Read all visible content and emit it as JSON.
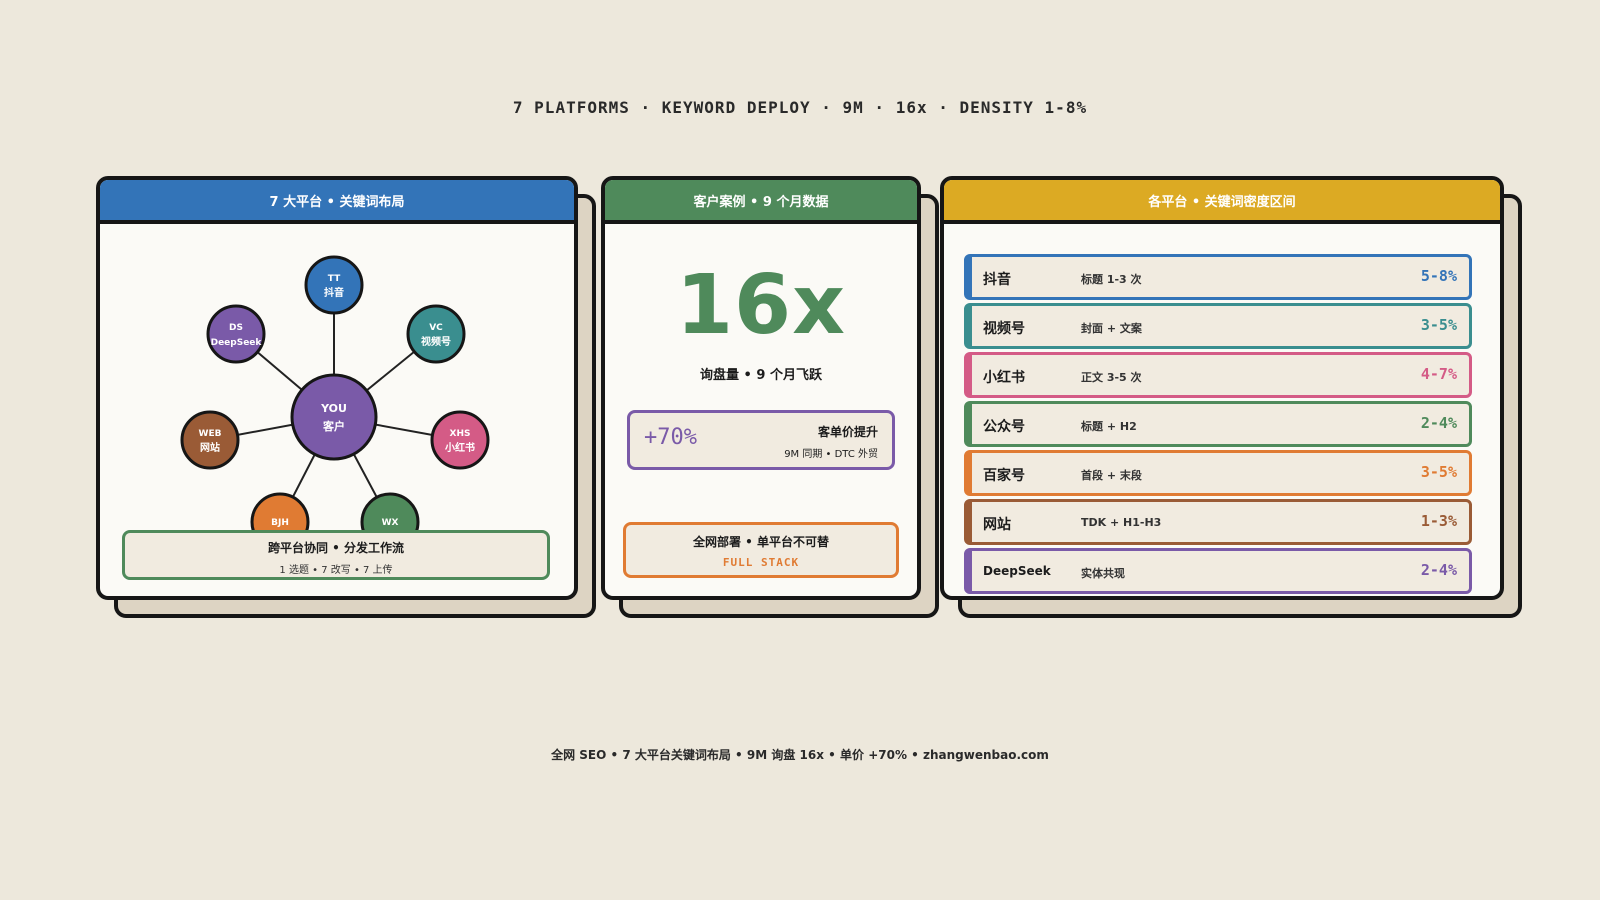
{
  "header": {
    "title": "7 PLATFORMS · KEYWORD DEPLOY · 9M · 16x · DENSITY 1-8%"
  },
  "footer": {
    "text": "全网 SEO • 7 大平台关键词布局 • 9M 询盘 16x • 单价 +70% • zhangwenbao.com"
  },
  "colors": {
    "blue": "#3374b8",
    "green": "#4f8a5b",
    "gold": "#dcaa23",
    "purple": "#7a5aa8",
    "teal": "#3a8e8f",
    "pink": "#d45b86",
    "orange": "#e07b33",
    "brown": "#9a5b36"
  },
  "panel1": {
    "title": "7 大平台 • 关键词布局",
    "hub": {
      "line1": "YOU",
      "line2": "客户"
    },
    "nodes": [
      {
        "code": "TT",
        "name": "抖音",
        "color": "#3374b8"
      },
      {
        "code": "VC",
        "name": "视频号",
        "color": "#3a8e8f"
      },
      {
        "code": "XHS",
        "name": "小红书",
        "color": "#d45b86"
      },
      {
        "code": "WX",
        "name": "",
        "color": "#4f8a5b"
      },
      {
        "code": "BJH",
        "name": "",
        "color": "#e07b33"
      },
      {
        "code": "WEB",
        "name": "网站",
        "color": "#9a5b36"
      },
      {
        "code": "DS",
        "name": "DeepSeek",
        "color": "#7a5aa8"
      }
    ],
    "sync": {
      "title": "跨平台协同 • 分发工作流",
      "sub": "1 选题 • 7 改写 • 7 上传"
    }
  },
  "panel2": {
    "title": "客户案例 • 9 个月数据",
    "big_value": "16x",
    "big_label": "询盘量 • 9 个月飞跃",
    "stat": {
      "value": "+70%",
      "title": "客单价提升",
      "sub": "9M 同期 • DTC 外贸"
    },
    "full": {
      "title": "全网部署 • 单平台不可替",
      "sub": "FULL STACK"
    }
  },
  "panel3": {
    "title": "各平台 • 关键词密度区间",
    "rows": [
      {
        "name": "抖音",
        "note": "标题 1-3 次",
        "range": "5-8%",
        "color": "#3374b8"
      },
      {
        "name": "视频号",
        "note": "封面 + 文案",
        "range": "3-5%",
        "color": "#3a8e8f"
      },
      {
        "name": "小红书",
        "note": "正文 3-5 次",
        "range": "4-7%",
        "color": "#d45b86"
      },
      {
        "name": "公众号",
        "note": "标题 + H2",
        "range": "2-4%",
        "color": "#4f8a5b"
      },
      {
        "name": "百家号",
        "note": "首段 + 末段",
        "range": "3-5%",
        "color": "#e07b33"
      },
      {
        "name": "网站",
        "note": "TDK + H1-H3",
        "range": "1-3%",
        "color": "#9a5b36"
      },
      {
        "name": "DeepSeek",
        "note": "实体共现",
        "range": "2-4%",
        "color": "#7a5aa8"
      }
    ]
  }
}
